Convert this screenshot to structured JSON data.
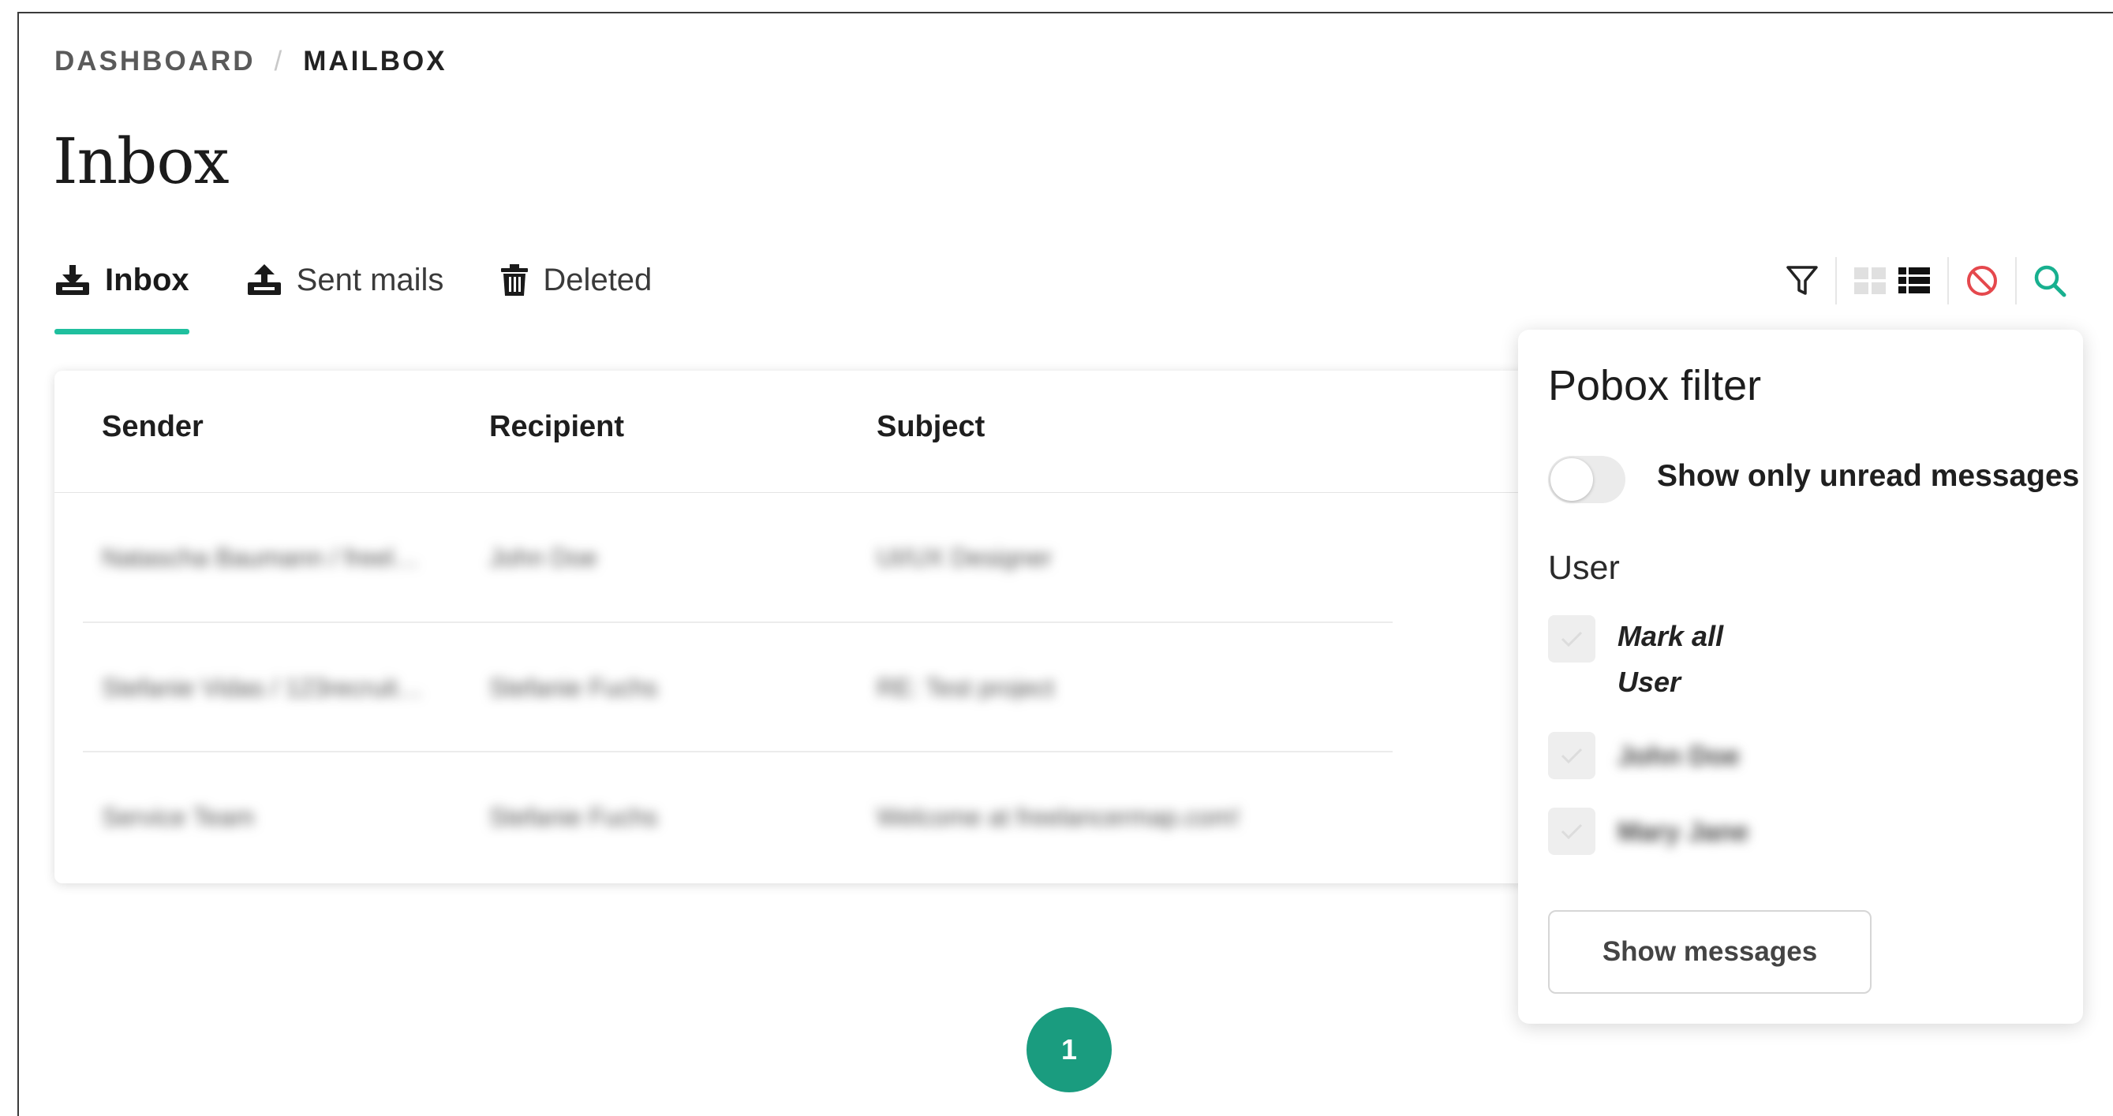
{
  "breadcrumb": {
    "parent": "DASHBOARD",
    "separator": "/",
    "current": "MAILBOX"
  },
  "page": {
    "title": "Inbox"
  },
  "tabs": [
    {
      "label": "Inbox",
      "icon": "inbox-download-icon",
      "active": true
    },
    {
      "label": "Sent mails",
      "icon": "outbox-upload-icon",
      "active": false
    },
    {
      "label": "Deleted",
      "icon": "trash-icon",
      "active": false
    }
  ],
  "toolbar": {
    "icons": [
      "filter-icon",
      "grid-view-icon",
      "list-view-icon",
      "clear-filter-icon",
      "search-icon"
    ]
  },
  "table": {
    "columns": [
      "Sender",
      "Recipient",
      "Subject"
    ],
    "rows": [
      {
        "sender": "Natascha Baumann / freel…",
        "recipient": "John Doe",
        "subject": "UI/UX Designer"
      },
      {
        "sender": "Stefanie Vidas / 123recruit…",
        "recipient": "Stefanie Fuchs",
        "subject": "RE: Test project"
      },
      {
        "sender": "Service Team",
        "recipient": "Stefanie Fuchs",
        "subject": "Welcome at freelancermap.com!"
      }
    ]
  },
  "filter_popup": {
    "title": "Pobox filter",
    "toggle_label": "Show only unread messages",
    "toggle_on": false,
    "section_label": "User",
    "mark_all_label_line1": "Mark all",
    "mark_all_label_line2": "User",
    "users": [
      "John Doe",
      "Mary Jane"
    ],
    "button_label": "Show messages"
  },
  "pagination": {
    "current_page": "1"
  },
  "colors": {
    "accent": "#1fbf9e",
    "pager": "#1a9c7f",
    "danger": "#e5484d",
    "search": "#18b08f"
  }
}
